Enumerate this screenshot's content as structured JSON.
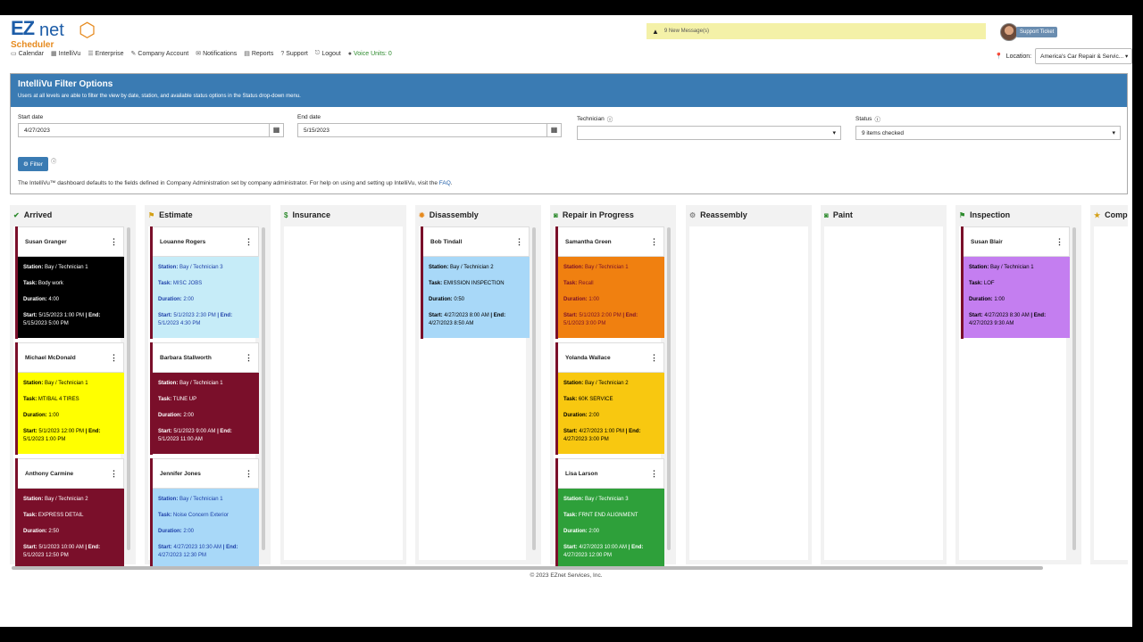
{
  "app": {
    "logo_ez": "EZ",
    "logo_net": "net",
    "logo_sub": "Scheduler"
  },
  "nav": [
    {
      "label": "Calendar",
      "icon": "calendar-icon",
      "glyph": "▭"
    },
    {
      "label": "IntelliVu",
      "icon": "grid-icon",
      "glyph": "▦"
    },
    {
      "label": "Enterprise",
      "icon": "list-icon",
      "glyph": "☰"
    },
    {
      "label": "Company Account",
      "icon": "wrench-icon",
      "glyph": "✎"
    },
    {
      "label": "Notifications",
      "icon": "envelope-icon",
      "glyph": "✉"
    },
    {
      "label": "Reports",
      "icon": "reports-icon",
      "glyph": "▤"
    },
    {
      "label": "Support",
      "icon": "question-icon",
      "glyph": "?"
    },
    {
      "label": "Logout",
      "icon": "logout-icon",
      "glyph": "⎋"
    },
    {
      "label": "Voice Units: 0",
      "icon": "mic-icon",
      "glyph": "●"
    }
  ],
  "messages": {
    "text": "9 New Message(s)"
  },
  "support": {
    "label": "Support Ticket"
  },
  "location": {
    "label": "Location:",
    "value": "America's Car Repair & Servic..."
  },
  "filter": {
    "title": "IntelliVu Filter Options",
    "description": "Users at all levels are able to filter the view by date, station, and available status options in the Status drop-down menu.",
    "start_label": "Start date",
    "start_value": "4/27/2023",
    "end_label": "End date",
    "end_value": "5/15/2023",
    "tech_label": "Technician",
    "tech_value": "",
    "status_label": "Status",
    "status_value": "9 items checked",
    "button": "Filter",
    "note": "The IntelliVu™ dashboard defaults to the fields defined in Company Administration set by company administrator. For help on using and setting up IntelliVu, visit the",
    "faq": "FAQ",
    "note_end": "."
  },
  "card_labels": {
    "station": "Station:",
    "task": "Task:",
    "duration": "Duration:",
    "start": "Start:",
    "end": "| End:"
  },
  "columns": [
    {
      "title": "Arrived",
      "icon": "check-circle-icon",
      "glyph": "✔",
      "icon_color": "#2e8b2e",
      "cards": [
        {
          "name": "Susan Granger",
          "station": "Bay / Technician 1",
          "task": "Body work",
          "duration": "4:00",
          "start": "5/15/2023 1:00 PM",
          "end": "5/15/2023 5:00 PM",
          "bg": "#000000",
          "fg": "#ffffff"
        },
        {
          "name": "Michael McDonald",
          "station": "Bay / Technician 1",
          "task": "MT/BAL 4 TIRES",
          "duration": "1:00",
          "start": "5/1/2023 12:00 PM",
          "end": "5/1/2023 1:00 PM",
          "bg": "#ffff00",
          "fg": "#000000"
        },
        {
          "name": "Anthony Carmine",
          "station": "Bay / Technician 2",
          "task": "EXPRESS DETAIL",
          "duration": "2:50",
          "start": "5/1/2023 10:00 AM",
          "end": "5/1/2023 12:50 PM",
          "bg": "#7a0f2a",
          "fg": "#ffffff"
        }
      ]
    },
    {
      "title": "Estimate",
      "icon": "flag-icon",
      "glyph": "⚑",
      "icon_color": "#d4a017",
      "cards": [
        {
          "name": "Louanne Rogers",
          "station": "Bay / Technician 3",
          "task": "MISC JOBS",
          "duration": "2:00",
          "start": "5/1/2023 2:30 PM",
          "end": "5/1/2023 4:30 PM",
          "bg": "#c6ecf8",
          "fg": "#1d3fa8"
        },
        {
          "name": "Barbara Stallworth",
          "station": "Bay / Technician 1",
          "task": "TUNE UP",
          "duration": "2:00",
          "start": "5/1/2023 9:00 AM",
          "end": "5/1/2023 11:00 AM",
          "bg": "#7a0f2a",
          "fg": "#ffffff"
        },
        {
          "name": "Jennifer Jones",
          "station": "Bay / Technician 1",
          "task": "Noise Concern Exterior",
          "duration": "2:00",
          "start": "4/27/2023 10:30 AM",
          "end": "4/27/2023 12:30 PM",
          "bg": "#a8d8f8",
          "fg": "#1d3fa8"
        }
      ]
    },
    {
      "title": "Insurance",
      "icon": "dollar-icon",
      "glyph": "$",
      "icon_color": "#2e8b2e",
      "cards": []
    },
    {
      "title": "Disassembly",
      "icon": "gear-icon",
      "glyph": "✹",
      "icon_color": "#e68a1e",
      "cards": [
        {
          "name": "Bob Tindall",
          "station": "Bay / Technician 2",
          "task": "EMISSION INSPECTION",
          "duration": "0:50",
          "start": "4/27/2023 8:00 AM",
          "end": "4/27/2023 8:50 AM",
          "bg": "#a8d8f8",
          "fg": "#000000"
        }
      ]
    },
    {
      "title": "Repair in Progress",
      "icon": "repair-icon",
      "glyph": "◙",
      "icon_color": "#2e8b2e",
      "cards": [
        {
          "name": "Samantha Green",
          "station": "Bay / Technician 1",
          "task": "Recall",
          "duration": "1:00",
          "start": "5/1/2023 2:00 PM",
          "end": "5/1/2023 3:00 PM",
          "bg": "#f08010",
          "fg": "#7a0f2a"
        },
        {
          "name": "Yolanda Wallace",
          "station": "Bay / Technician 2",
          "task": "60K SERVICE",
          "duration": "2:00",
          "start": "4/27/2023 1:00 PM",
          "end": "4/27/2023 3:00 PM",
          "bg": "#f8c810",
          "fg": "#000000"
        },
        {
          "name": "Lisa Larson",
          "station": "Bay / Technician 3",
          "task": "FRNT END ALIGNMENT",
          "duration": "2:00",
          "start": "4/27/2023 10:00 AM",
          "end": "4/27/2023 12:00 PM",
          "bg": "#2ea03a",
          "fg": "#ffffff"
        }
      ]
    },
    {
      "title": "Reassembly",
      "icon": "cog-icon",
      "glyph": "⚙",
      "icon_color": "#888888",
      "cards": []
    },
    {
      "title": "Paint",
      "icon": "paint-icon",
      "glyph": "◙",
      "icon_color": "#2e8b2e",
      "cards": []
    },
    {
      "title": "Inspection",
      "icon": "flag-icon",
      "glyph": "⚑",
      "icon_color": "#2e8b2e",
      "cards": [
        {
          "name": "Susan Blair",
          "station": "Bay / Technician 1",
          "task": "LOF",
          "duration": "1:00",
          "start": "4/27/2023 8:30 AM",
          "end": "4/27/2023 9:30 AM",
          "bg": "#c47ef0",
          "fg": "#000000"
        }
      ]
    },
    {
      "title": "Comp",
      "icon": "star-icon",
      "glyph": "★",
      "icon_color": "#d4a017",
      "cards": []
    }
  ],
  "footer": "© 2023 EZnet Services, Inc."
}
